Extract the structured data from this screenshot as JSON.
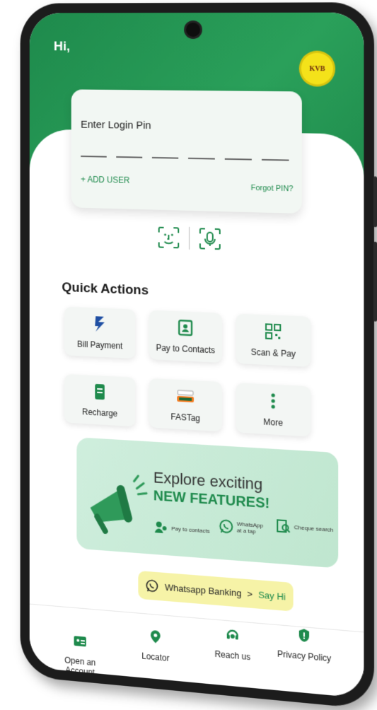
{
  "greeting": "Hi,",
  "logo_text": "KVB",
  "login": {
    "title": "Enter Login Pin",
    "add_user": "+ ADD USER",
    "forgot_pin": "Forgot PIN?"
  },
  "quick_actions": {
    "title": "Quick Actions",
    "items": [
      {
        "label": "Bill Payment",
        "icon": "bill-payment-icon"
      },
      {
        "label": "Pay to Contacts",
        "icon": "contacts-icon"
      },
      {
        "label": "Scan & Pay",
        "icon": "qr-scan-icon"
      },
      {
        "label": "Recharge",
        "icon": "mobile-recharge-icon"
      },
      {
        "label": "FASTag",
        "icon": "fastag-icon"
      },
      {
        "label": "More",
        "icon": "more-vertical-icon"
      }
    ]
  },
  "banner": {
    "line1": "Explore exciting",
    "line2": "NEW FEATURES!",
    "features": [
      "Pay to contacts",
      "WhatsApp at a tap",
      "Cheque search"
    ]
  },
  "whatsapp": {
    "label": "Whatsapp Banking",
    "arrow": ">",
    "action": "Say Hi"
  },
  "bottom_nav": [
    {
      "label": "Open an Account",
      "icon": "account-card-icon"
    },
    {
      "label": "Locator",
      "icon": "location-pin-icon"
    },
    {
      "label": "Reach us",
      "icon": "support-icon"
    },
    {
      "label": "Privacy Policy",
      "icon": "shield-icon"
    }
  ],
  "colors": {
    "primary": "#1e8a4c",
    "accent": "#f4e21a",
    "banner": "#cfeedd",
    "whatsapp_pill": "#f6f3a7"
  }
}
